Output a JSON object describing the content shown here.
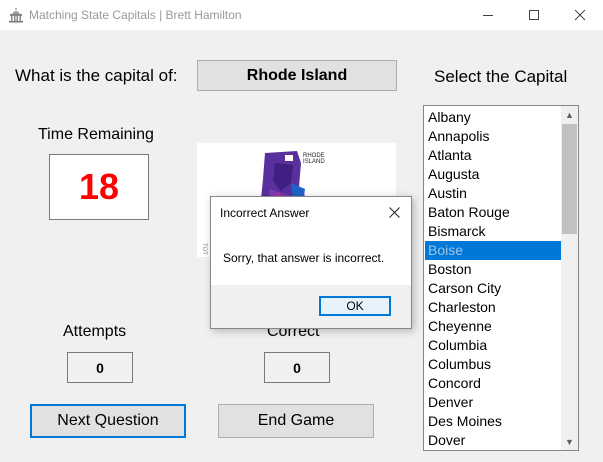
{
  "window": {
    "title": "Matching State Capitals  | Brett Hamilton",
    "icons": {
      "app": "capitol-building-icon",
      "minimize": "minimize-icon",
      "maximize": "maximize-icon",
      "close": "close-icon"
    }
  },
  "question": {
    "prompt": "What is the capital of:",
    "state": "Rhode Island"
  },
  "select_label": "Select the Capital",
  "timer": {
    "label": "Time Remaining",
    "value": "18",
    "color": "#ff0000"
  },
  "map": {
    "state_label_line1": "RHODE",
    "state_label_line2": "ISLAND",
    "partial_side_text": "TOT"
  },
  "capitals_list": {
    "items": [
      "Albany",
      "Annapolis",
      "Atlanta",
      "Augusta",
      "Austin",
      "Baton Rouge",
      "Bismarck",
      "Boise",
      "Boston",
      "Carson City",
      "Charleston",
      "Cheyenne",
      "Columbia",
      "Columbus",
      "Concord",
      "Denver",
      "Des Moines",
      "Dover"
    ],
    "selected": "Boise",
    "selected_color": "#0078d7"
  },
  "stats": {
    "attempts_label": "Attempts",
    "attempts_value": "0",
    "correct_label": "Correct",
    "correct_value": "0"
  },
  "buttons": {
    "next": "Next Question",
    "end": "End Game"
  },
  "dialog": {
    "title": "Incorrect Answer",
    "message": "Sorry, that answer is incorrect.",
    "ok": "OK"
  }
}
